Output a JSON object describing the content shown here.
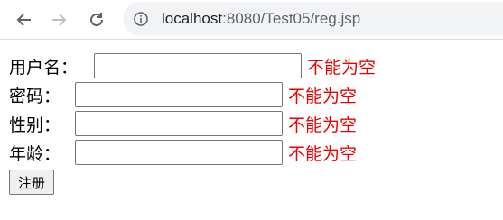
{
  "browser": {
    "url_host": "localhost",
    "url_rest": ":8080/Test05/reg.jsp"
  },
  "form": {
    "fields": [
      {
        "label": "用户名：",
        "value": "",
        "error": "不能为空"
      },
      {
        "label": "密码：",
        "value": "",
        "error": "不能为空"
      },
      {
        "label": "性别：",
        "value": "",
        "error": "不能为空"
      },
      {
        "label": "年龄：",
        "value": "",
        "error": "不能为空"
      }
    ],
    "submit_label": "注册"
  },
  "colors": {
    "error": "#ee0000",
    "omnibox": "#f1f3f4"
  }
}
